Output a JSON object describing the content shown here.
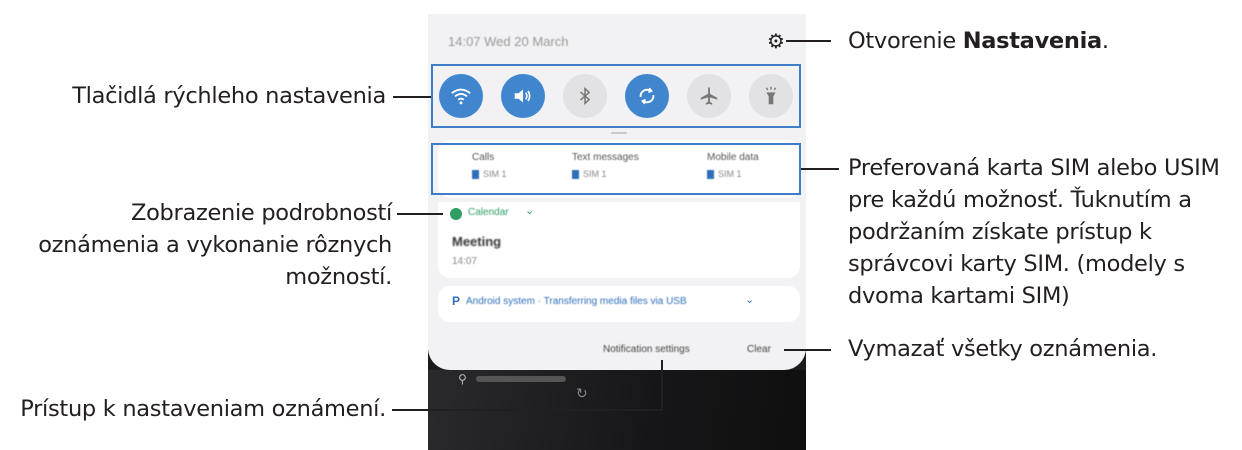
{
  "labels": {
    "quick_buttons": "Tlačidlá rýchleho nastavenia",
    "open_settings_prefix": "Otvorenie ",
    "open_settings_bold": "Nastavenia",
    "open_settings_suffix": ".",
    "details_line1": "Zobrazenie podrobností",
    "details_line2": "oznámenia a vykonanie rôznych",
    "details_line3": "možností.",
    "sim_line1": "Preferovaná karta SIM alebo USIM",
    "sim_line2": "pre každú možnosť. Ťuknutím a",
    "sim_line3": "podržaním získate prístup k",
    "sim_line4": "správcovi karty SIM. (modely s",
    "sim_line5": "dvoma kartami SIM)",
    "clear_all": "Vymazať všetky oznámenia.",
    "notif_settings_access": "Prístup k nastaveniam oznámení."
  },
  "phone": {
    "status_time": "14:07  Wed 20 March",
    "quick_settings": [
      {
        "name": "wifi",
        "icon": "wifi-icon",
        "state": "on"
      },
      {
        "name": "sound",
        "icon": "volume-icon",
        "state": "on"
      },
      {
        "name": "bluetooth",
        "icon": "bluetooth-icon",
        "state": "off"
      },
      {
        "name": "auto-rotate",
        "icon": "rotate-icon",
        "state": "on"
      },
      {
        "name": "airplane",
        "icon": "airplane-icon",
        "state": "off"
      },
      {
        "name": "flashlight",
        "icon": "flashlight-icon",
        "state": "off"
      }
    ],
    "sim": [
      {
        "title": "Calls",
        "value": "SIM 1"
      },
      {
        "title": "Text messages",
        "value": "SIM 1"
      },
      {
        "title": "Mobile data",
        "value": "SIM 1"
      }
    ],
    "calendar": {
      "app": "Calendar",
      "title": "Meeting",
      "sub": "14:07"
    },
    "android_notice": "Android system · Transferring media files via USB",
    "notification_settings": "Notification settings",
    "clear": "Clear",
    "accent_color": "#3f86cf",
    "frame_color": "#3d7ec6"
  }
}
